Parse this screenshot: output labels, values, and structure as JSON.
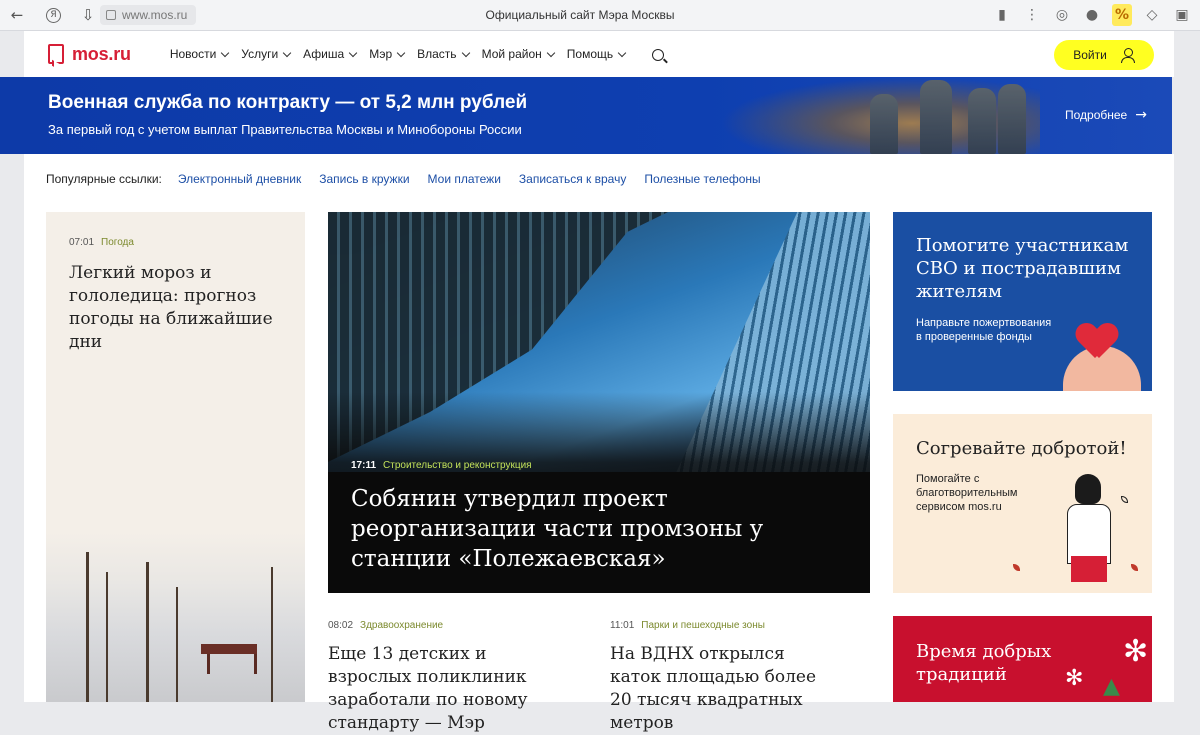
{
  "browser": {
    "url": "www.mos.ru",
    "title": "Официальный сайт Мэра Москвы"
  },
  "header": {
    "logo": "mos.ru",
    "nav": [
      "Новости",
      "Услуги",
      "Афиша",
      "Мэр",
      "Власть",
      "Мой район",
      "Помощь"
    ],
    "login_label": "Войти"
  },
  "banner": {
    "title": "Военная служба по контракту — от 5,2 млн рублей",
    "subtitle": "За первый год с учетом выплат Правительства Москвы и Минобороны России",
    "more_label": "Подробнее"
  },
  "popular": {
    "label": "Популярные ссылки:",
    "links": [
      "Электронный дневник",
      "Запись в кружки",
      "Мои платежи",
      "Записаться к врачу",
      "Полезные телефоны"
    ]
  },
  "weather_card": {
    "time": "07:01",
    "category": "Погода",
    "title": "Легкий мороз и гололедица: прогноз погоды на ближайшие дни"
  },
  "hero": {
    "time": "17:11",
    "category": "Строительство и реконструкция",
    "title": "Собянин утвердил проект реорганизации части промзоны у станции «Полежаевская»"
  },
  "news": [
    {
      "time": "08:02",
      "category": "Здравоохранение",
      "title": "Еще 13 детских и взрослых поликлиник заработали по новому стандарту — Мэр"
    },
    {
      "time": "11:01",
      "category": "Парки и пешеходные зоны",
      "title": "На ВДНХ открылся каток площадью более 20 тысяч квадратных метров"
    }
  ],
  "promo": [
    {
      "title": "Помогите участникам СВО и пострадавшим жителям",
      "subtitle": "Направьте пожертвования в проверенные фонды"
    },
    {
      "title": "Согревайте добротой!",
      "subtitle": "Помогайте с благотворительным сервисом mos.ru"
    },
    {
      "title": "Время добрых традиций"
    }
  ],
  "colors": {
    "brand_red": "#d61f36",
    "banner_blue": "#0e3fb0",
    "link_blue": "#1d4fa6",
    "login_highlight": "#ffff21",
    "category_green": "#7c8a2e"
  }
}
